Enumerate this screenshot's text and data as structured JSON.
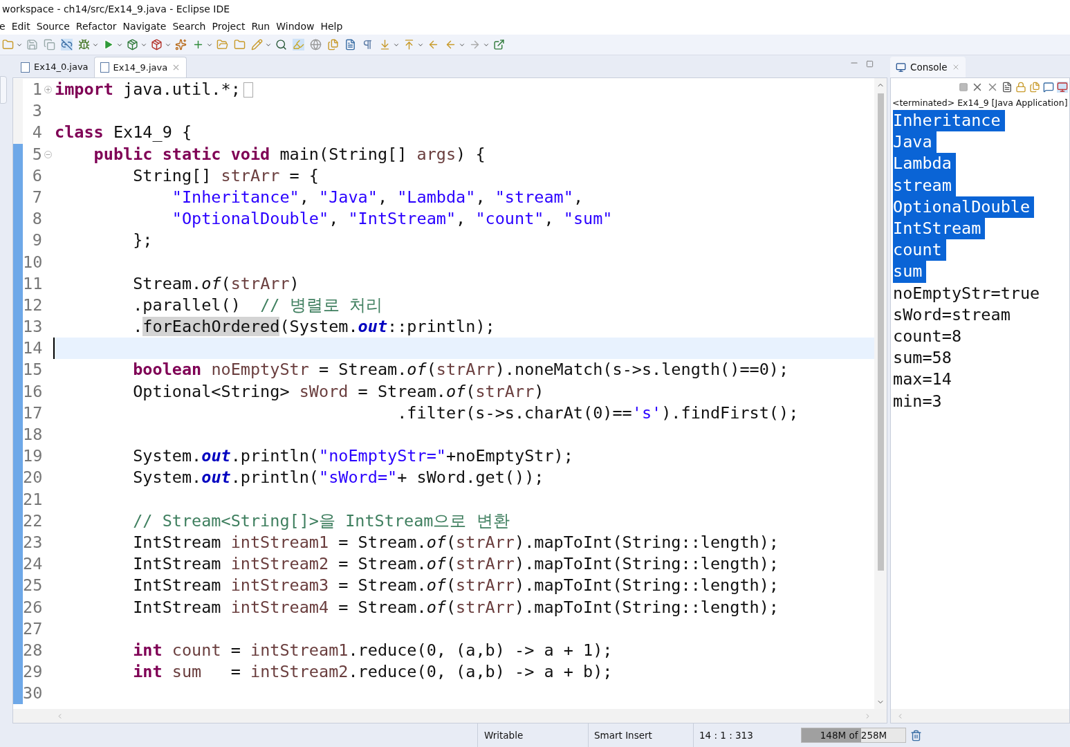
{
  "window": {
    "title": "workspace - ch14/src/Ex14_9.java - Eclipse IDE"
  },
  "menu": [
    "e",
    "Edit",
    "Source",
    "Refactor",
    "Navigate",
    "Search",
    "Project",
    "Run",
    "Window",
    "Help"
  ],
  "editor_tabs": [
    {
      "label": "Ex14_0.java",
      "selected": false
    },
    {
      "label": "Ex14_9.java",
      "selected": true
    }
  ],
  "code_lines": [
    {
      "number": "1",
      "kind": "folded",
      "changed": false,
      "current": false,
      "tokens": [
        {
          "kind": "kw",
          "t": "import"
        },
        {
          "kind": "p",
          "t": " java.util.*;"
        }
      ]
    },
    {
      "number": "3",
      "kind": "plain",
      "changed": false,
      "current": false
    },
    {
      "number": "4",
      "kind": "plain",
      "changed": false,
      "current": false,
      "tokens": [
        {
          "kind": "kw",
          "t": "class"
        },
        {
          "kind": "p",
          "t": " Ex14_9 {"
        }
      ]
    },
    {
      "number": "5",
      "kind": "foldable",
      "changed": true,
      "current": false,
      "tokens": [
        {
          "kind": "kw",
          "t": "    public static void"
        },
        {
          "kind": "p",
          "t": " main(String[] "
        },
        {
          "kind": "v",
          "t": "args"
        },
        {
          "kind": "p",
          "t": ") {"
        }
      ]
    },
    {
      "number": "6",
      "kind": "plain",
      "changed": true,
      "current": false,
      "tokens": [
        {
          "kind": "p",
          "t": "        String[] "
        },
        {
          "kind": "v",
          "t": "strArr"
        },
        {
          "kind": "p",
          "t": " = {"
        }
      ]
    },
    {
      "number": "7",
      "kind": "plain",
      "changed": true,
      "current": false,
      "tokens": [
        {
          "kind": "s",
          "t": "            \"Inheritance\""
        },
        {
          "kind": "p",
          "t": ", "
        },
        {
          "kind": "s",
          "t": "\"Java\""
        },
        {
          "kind": "p",
          "t": ", "
        },
        {
          "kind": "s",
          "t": "\"Lambda\""
        },
        {
          "kind": "p",
          "t": ", "
        },
        {
          "kind": "s",
          "t": "\"stream\""
        },
        {
          "kind": "p",
          "t": ","
        }
      ]
    },
    {
      "number": "8",
      "kind": "plain",
      "changed": true,
      "current": false,
      "tokens": [
        {
          "kind": "s",
          "t": "            \"OptionalDouble\""
        },
        {
          "kind": "p",
          "t": ", "
        },
        {
          "kind": "s",
          "t": "\"IntStream\""
        },
        {
          "kind": "p",
          "t": ", "
        },
        {
          "kind": "s",
          "t": "\"count\""
        },
        {
          "kind": "p",
          "t": ", "
        },
        {
          "kind": "s",
          "t": "\"sum\""
        }
      ]
    },
    {
      "number": "9",
      "kind": "plain",
      "changed": true,
      "current": false,
      "tokens": [
        {
          "kind": "p",
          "t": "        };"
        }
      ]
    },
    {
      "number": "10",
      "kind": "plain",
      "changed": true,
      "current": false
    },
    {
      "number": "11",
      "kind": "plain",
      "changed": true,
      "current": false,
      "tokens": [
        {
          "kind": "p",
          "t": "        Stream."
        },
        {
          "kind": "st",
          "t": "of"
        },
        {
          "kind": "p",
          "t": "("
        },
        {
          "kind": "v",
          "t": "strArr"
        },
        {
          "kind": "p",
          "t": ")"
        }
      ]
    },
    {
      "number": "12",
      "kind": "plain",
      "changed": true,
      "current": false,
      "tokens": [
        {
          "kind": "p",
          "t": "        .parallel()  "
        },
        {
          "kind": "c",
          "t": "// 병렬로 처리"
        }
      ]
    },
    {
      "number": "13",
      "kind": "plain",
      "changed": true,
      "current": false,
      "tokens": [
        {
          "kind": "p",
          "t": "        ."
        },
        {
          "kind": "hl",
          "t": "forEachOrdered"
        },
        {
          "kind": "p",
          "t": "(System."
        },
        {
          "kind": "f",
          "t": "out"
        },
        {
          "kind": "p",
          "t": "::println);"
        }
      ]
    },
    {
      "number": "14",
      "kind": "plain",
      "changed": true,
      "current": true
    },
    {
      "number": "15",
      "kind": "plain",
      "changed": true,
      "current": false,
      "tokens": [
        {
          "kind": "kw",
          "t": "        boolean"
        },
        {
          "kind": "v",
          "t": " noEmptyStr"
        },
        {
          "kind": "p",
          "t": " = Stream."
        },
        {
          "kind": "st",
          "t": "of"
        },
        {
          "kind": "p",
          "t": "("
        },
        {
          "kind": "v",
          "t": "strArr"
        },
        {
          "kind": "p",
          "t": ").noneMatch(s->s.length()==0);"
        }
      ]
    },
    {
      "number": "16",
      "kind": "plain",
      "changed": true,
      "current": false,
      "tokens": [
        {
          "kind": "p",
          "t": "        Optional<String> "
        },
        {
          "kind": "v",
          "t": "sWord"
        },
        {
          "kind": "p",
          "t": " = Stream."
        },
        {
          "kind": "st",
          "t": "of"
        },
        {
          "kind": "p",
          "t": "("
        },
        {
          "kind": "v",
          "t": "strArr"
        },
        {
          "kind": "p",
          "t": ")"
        }
      ]
    },
    {
      "number": "17",
      "kind": "plain",
      "changed": true,
      "current": false,
      "tokens": [
        {
          "kind": "p",
          "t": "                                   .filter(s->s.charAt(0)=="
        },
        {
          "kind": "s",
          "t": "'s'"
        },
        {
          "kind": "p",
          "t": ").findFirst();"
        }
      ]
    },
    {
      "number": "18",
      "kind": "plain",
      "changed": true,
      "current": false
    },
    {
      "number": "19",
      "kind": "plain",
      "changed": true,
      "current": false,
      "tokens": [
        {
          "kind": "p",
          "t": "        System."
        },
        {
          "kind": "f",
          "t": "out"
        },
        {
          "kind": "p",
          "t": ".println("
        },
        {
          "kind": "s",
          "t": "\"noEmptyStr=\""
        },
        {
          "kind": "p",
          "t": "+noEmptyStr);"
        }
      ]
    },
    {
      "number": "20",
      "kind": "plain",
      "changed": true,
      "current": false,
      "tokens": [
        {
          "kind": "p",
          "t": "        System."
        },
        {
          "kind": "f",
          "t": "out"
        },
        {
          "kind": "p",
          "t": ".println("
        },
        {
          "kind": "s",
          "t": "\"sWord=\""
        },
        {
          "kind": "p",
          "t": "+ sWord.get());"
        }
      ]
    },
    {
      "number": "21",
      "kind": "plain",
      "changed": true,
      "current": false
    },
    {
      "number": "22",
      "kind": "plain",
      "changed": true,
      "current": false,
      "tokens": [
        {
          "kind": "c",
          "t": "        // Stream<String[]>을 IntStream으로 변환"
        }
      ]
    },
    {
      "number": "23",
      "kind": "plain",
      "changed": true,
      "current": false,
      "tokens": [
        {
          "kind": "p",
          "t": "        IntStream "
        },
        {
          "kind": "v",
          "t": "intStream1"
        },
        {
          "kind": "p",
          "t": " = Stream."
        },
        {
          "kind": "st",
          "t": "of"
        },
        {
          "kind": "p",
          "t": "("
        },
        {
          "kind": "v",
          "t": "strArr"
        },
        {
          "kind": "p",
          "t": ").mapToInt(String::length);"
        }
      ]
    },
    {
      "number": "24",
      "kind": "plain",
      "changed": true,
      "current": false,
      "tokens": [
        {
          "kind": "p",
          "t": "        IntStream "
        },
        {
          "kind": "v",
          "t": "intStream2"
        },
        {
          "kind": "p",
          "t": " = Stream."
        },
        {
          "kind": "st",
          "t": "of"
        },
        {
          "kind": "p",
          "t": "("
        },
        {
          "kind": "v",
          "t": "strArr"
        },
        {
          "kind": "p",
          "t": ").mapToInt(String::length);"
        }
      ]
    },
    {
      "number": "25",
      "kind": "plain",
      "changed": true,
      "current": false,
      "tokens": [
        {
          "kind": "p",
          "t": "        IntStream "
        },
        {
          "kind": "v",
          "t": "intStream3"
        },
        {
          "kind": "p",
          "t": " = Stream."
        },
        {
          "kind": "st",
          "t": "of"
        },
        {
          "kind": "p",
          "t": "("
        },
        {
          "kind": "v",
          "t": "strArr"
        },
        {
          "kind": "p",
          "t": ").mapToInt(String::length);"
        }
      ]
    },
    {
      "number": "26",
      "kind": "plain",
      "changed": true,
      "current": false,
      "tokens": [
        {
          "kind": "p",
          "t": "        IntStream "
        },
        {
          "kind": "v",
          "t": "intStream4"
        },
        {
          "kind": "p",
          "t": " = Stream."
        },
        {
          "kind": "st",
          "t": "of"
        },
        {
          "kind": "p",
          "t": "("
        },
        {
          "kind": "v",
          "t": "strArr"
        },
        {
          "kind": "p",
          "t": ").mapToInt(String::length);"
        }
      ]
    },
    {
      "number": "27",
      "kind": "plain",
      "changed": true,
      "current": false
    },
    {
      "number": "28",
      "kind": "plain",
      "changed": true,
      "current": false,
      "tokens": [
        {
          "kind": "kw",
          "t": "        int"
        },
        {
          "kind": "v",
          "t": " count"
        },
        {
          "kind": "p",
          "t": " = "
        },
        {
          "kind": "v",
          "t": "intStream1"
        },
        {
          "kind": "p",
          "t": ".reduce(0, (a,b) -> a + 1);"
        }
      ]
    },
    {
      "number": "29",
      "kind": "plain",
      "changed": true,
      "current": false,
      "tokens": [
        {
          "kind": "kw",
          "t": "        int"
        },
        {
          "kind": "v",
          "t": " sum"
        },
        {
          "kind": "p",
          "t": "   = "
        },
        {
          "kind": "v",
          "t": "intStream2"
        },
        {
          "kind": "p",
          "t": ".reduce(0, (a,b) -> a + b);"
        }
      ]
    },
    {
      "number": "30",
      "kind": "plain",
      "changed": true,
      "current": false
    }
  ],
  "console": {
    "tab": "Console",
    "header": "<terminated> Ex14_9 [Java Application]",
    "lines": [
      {
        "text": "Inheritance",
        "selected": true
      },
      {
        "text": "Java",
        "selected": true
      },
      {
        "text": "Lambda",
        "selected": true
      },
      {
        "text": "stream",
        "selected": true
      },
      {
        "text": "OptionalDouble",
        "selected": true
      },
      {
        "text": "IntStream",
        "selected": true
      },
      {
        "text": "count",
        "selected": true
      },
      {
        "text": "sum",
        "selected": true
      },
      {
        "text": "noEmptyStr=true",
        "selected": false
      },
      {
        "text": "sWord=stream",
        "selected": false
      },
      {
        "text": "count=8",
        "selected": false
      },
      {
        "text": "sum=58",
        "selected": false
      },
      {
        "text": "max=14",
        "selected": false
      },
      {
        "text": "min=3",
        "selected": false
      }
    ]
  },
  "status_bar": {
    "mode": "Writable",
    "insert": "Smart Insert",
    "position": "14 : 1 : 313",
    "heap": {
      "text": "148M of 258M",
      "level": 0.57
    }
  }
}
